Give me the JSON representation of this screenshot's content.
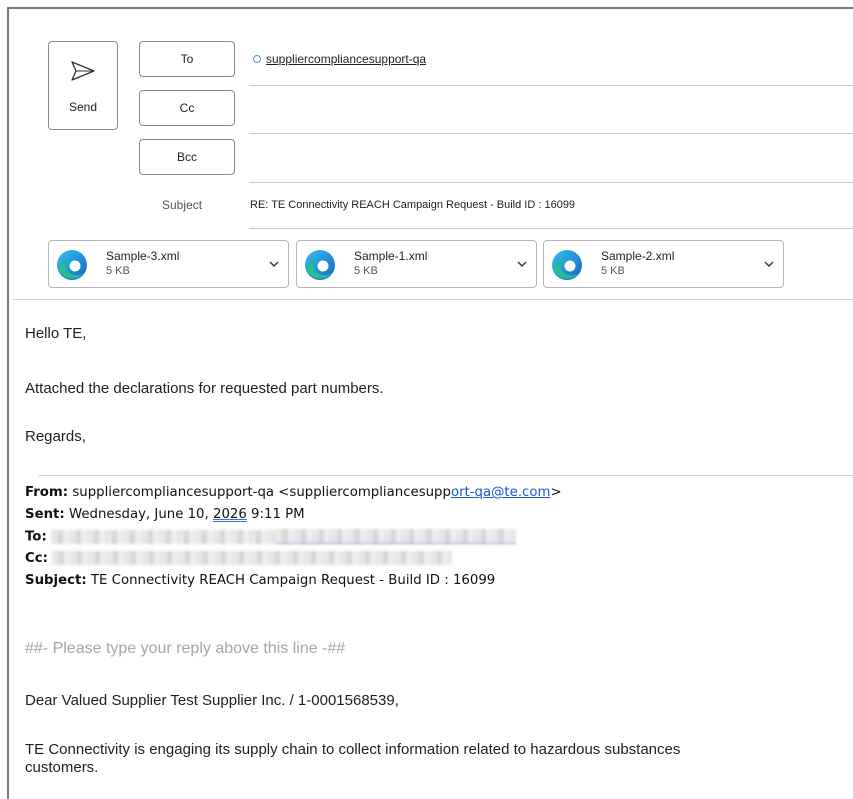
{
  "compose": {
    "send_label": "Send",
    "to_label": "To",
    "cc_label": "Cc",
    "bcc_label": "Bcc",
    "to_recipient": "suppliercompliancesupport-qa",
    "subject_label": "Subject",
    "subject_value": "RE: TE Connectivity REACH Campaign Request  -  Build ID : 16099"
  },
  "attachments": [
    {
      "name": "Sample-3.xml",
      "size": "5 KB",
      "icon": "edge-browser-icon"
    },
    {
      "name": "Sample-1.xml",
      "size": "5 KB",
      "icon": "edge-browser-icon"
    },
    {
      "name": "Sample-2.xml",
      "size": "5 KB",
      "icon": "edge-browser-icon"
    }
  ],
  "body": {
    "greeting": "Hello TE,",
    "line1": "Attached the declarations for requested part numbers.",
    "closing": "Regards,"
  },
  "quoted": {
    "from_label": "From:",
    "from_value": " suppliercompliancesupport-qa <suppliercompliancesupp",
    "from_link": "ort-qa@te.com",
    "from_end": ">",
    "sent_label": "Sent:",
    "sent_value_a": " Wednesday, June 10, ",
    "sent_year": "2026",
    "sent_value_b": " 9:11 PM",
    "to_label": "To:",
    "cc_label": "Cc:",
    "subject_label": "Subject:",
    "subject_value": " TE Connectivity REACH Campaign Request - Build ID : 16099",
    "reply_marker": "##- Please type your reply above this line -##",
    "dear_line": " Dear Valued Supplier Test Supplier Inc. / 1-0001568539,",
    "para_line1": "TE Connectivity is engaging its supply chain to collect information related to hazardous substances",
    "para_line2": "customers."
  },
  "colors": {
    "link": "#1a56d6",
    "ring": "#5b8fd6",
    "placeholder": "#a6a6a6"
  }
}
